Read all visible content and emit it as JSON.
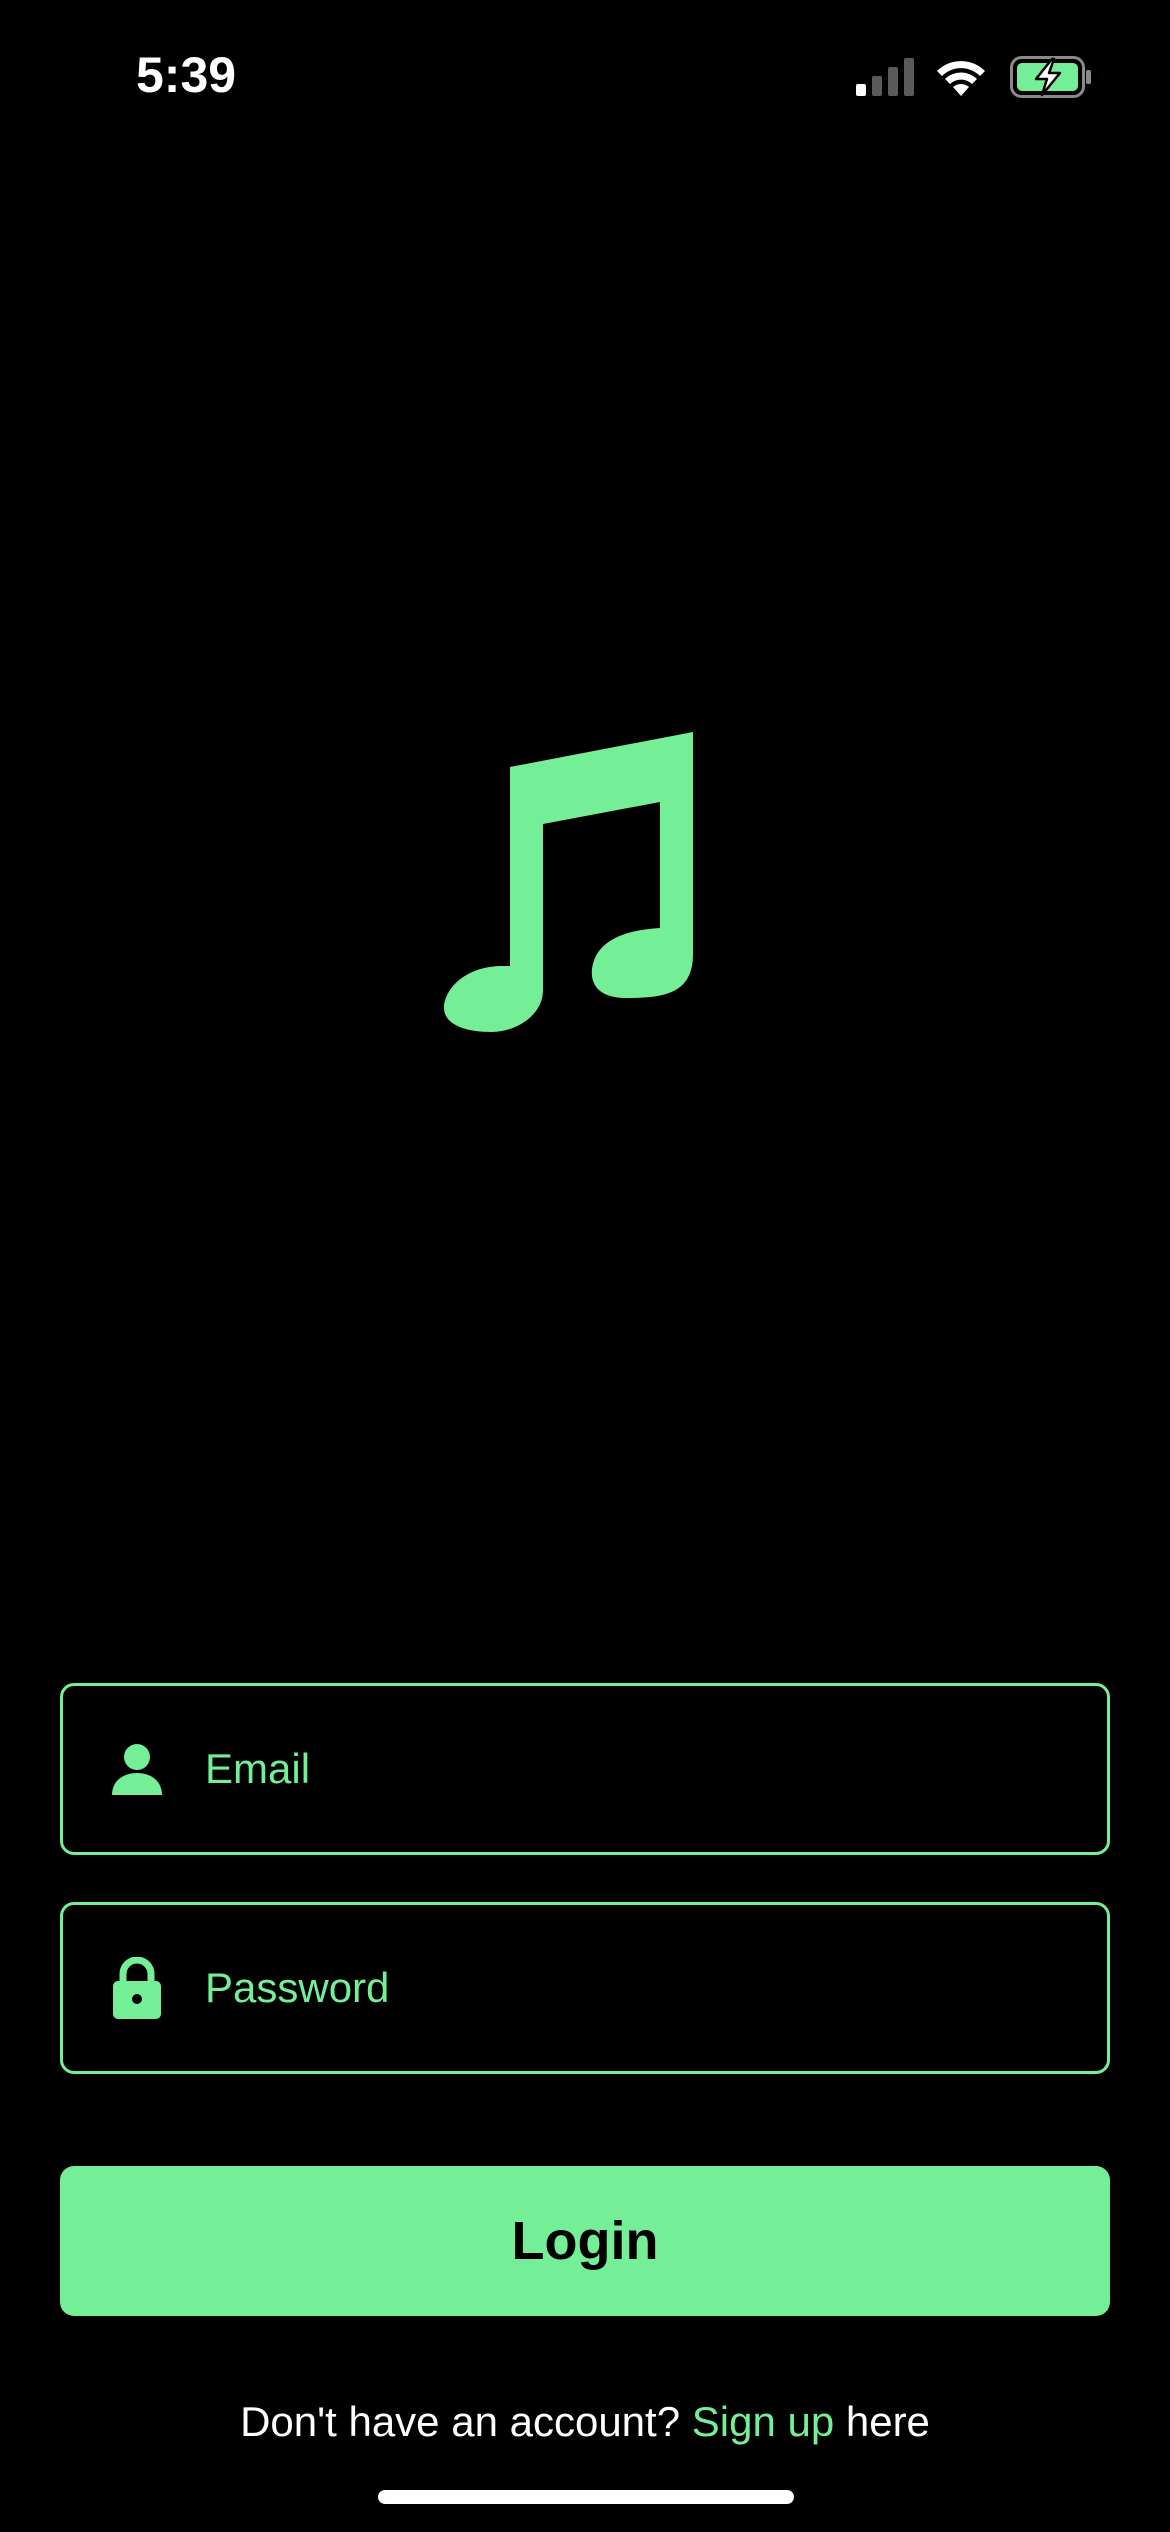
{
  "status_bar": {
    "time": "5:39",
    "signal_icon": "cellular-signal-icon",
    "wifi_icon": "wifi-icon",
    "battery_icon": "battery-charging-icon"
  },
  "logo": {
    "icon": "music-note-icon"
  },
  "form": {
    "email": {
      "placeholder": "Email",
      "value": "",
      "icon": "person-icon"
    },
    "password": {
      "placeholder": "Password",
      "value": "",
      "icon": "lock-icon"
    },
    "login_label": "Login"
  },
  "footer": {
    "prefix": "Don't have an account? ",
    "link": "Sign up",
    "suffix": " here"
  },
  "colors": {
    "accent": "#74ee97",
    "background": "#000000",
    "text": "#ffffff"
  }
}
